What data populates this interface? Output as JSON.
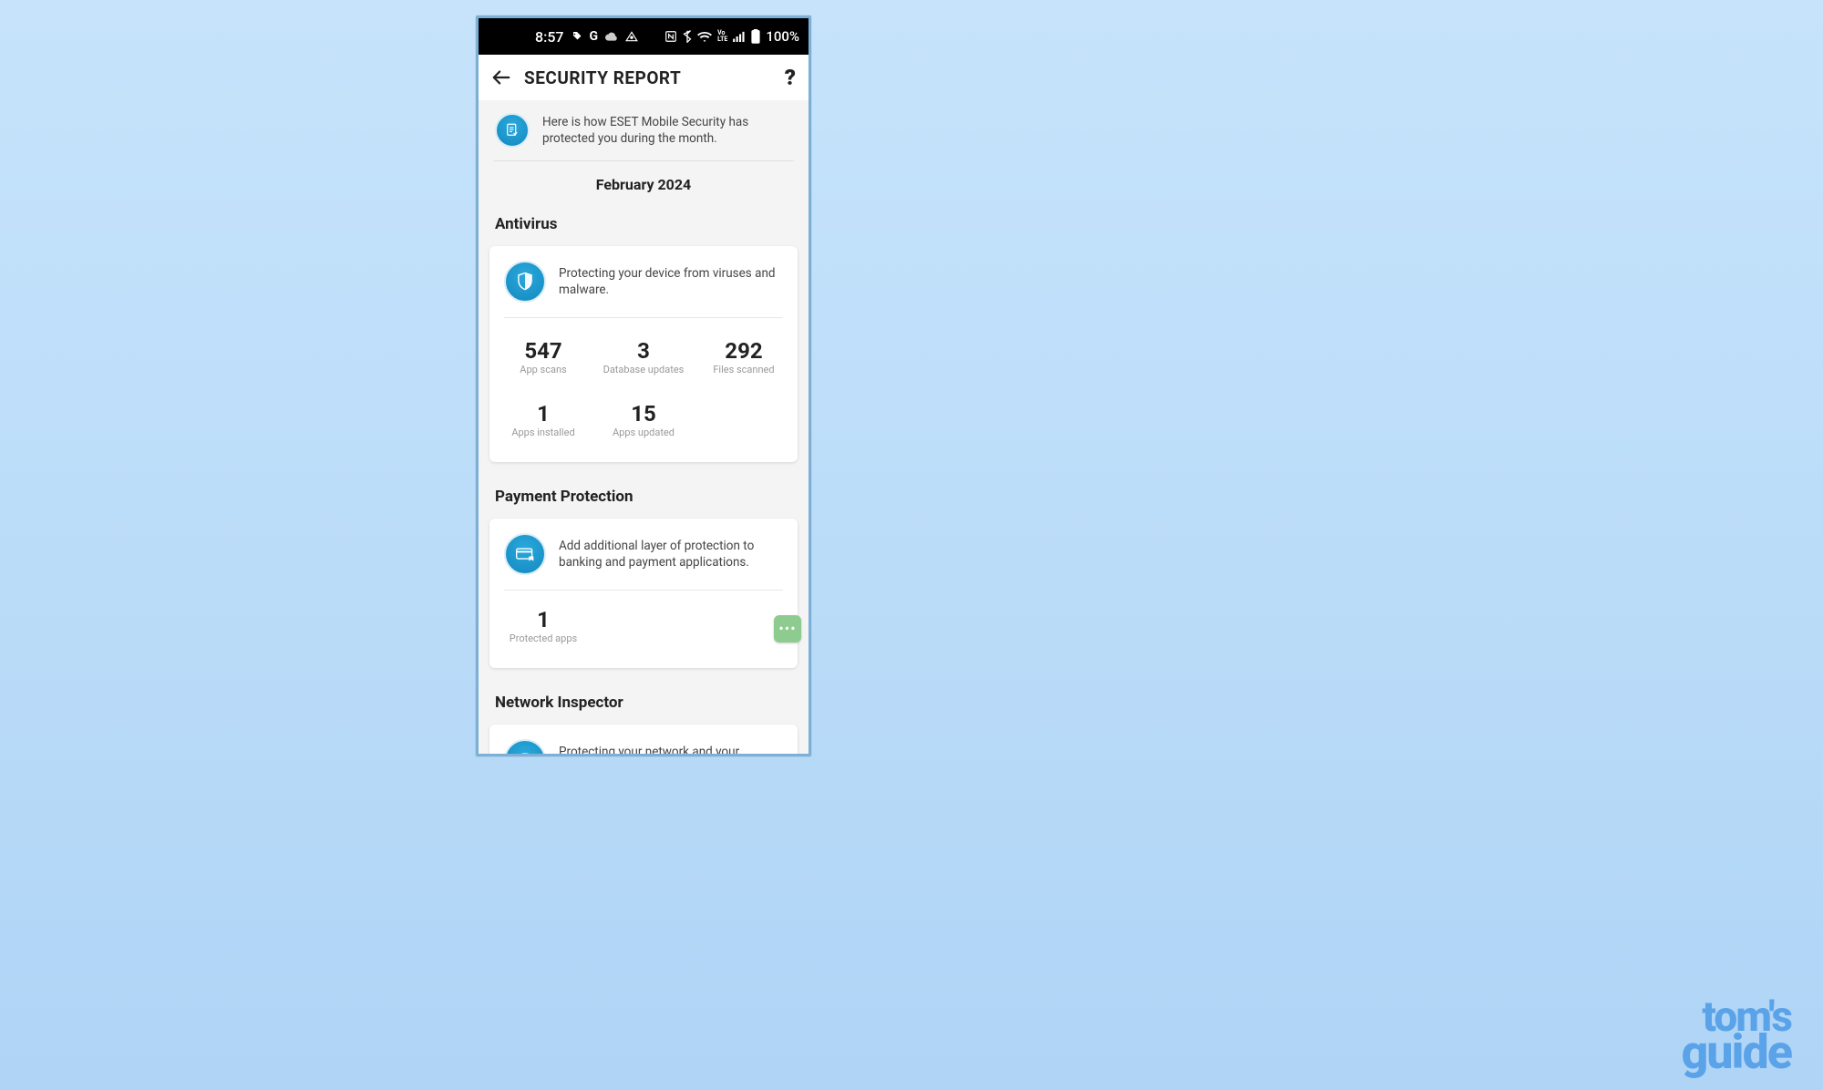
{
  "status_bar": {
    "time": "8:57",
    "battery_text": "100%"
  },
  "app_bar": {
    "title": "SECURITY REPORT"
  },
  "intro": {
    "text": "Here is how ESET Mobile Security has protected you during the month."
  },
  "month": "February 2024",
  "sections": {
    "antivirus": {
      "title": "Antivirus",
      "desc": "Protecting your device from viruses and malware.",
      "stats": [
        {
          "value": "547",
          "label": "App scans"
        },
        {
          "value": "3",
          "label": "Database updates"
        },
        {
          "value": "292",
          "label": "Files scanned"
        },
        {
          "value": "1",
          "label": "Apps installed"
        },
        {
          "value": "15",
          "label": "Apps updated"
        }
      ]
    },
    "payment": {
      "title": "Payment Protection",
      "desc": "Add additional layer of protection to banking and payment applications.",
      "stats": [
        {
          "value": "1",
          "label": "Protected apps"
        }
      ]
    },
    "network": {
      "title": "Network Inspector",
      "desc": "Protecting your network and your devices."
    }
  },
  "watermark": {
    "line1": "tom's",
    "line2": "guide"
  }
}
